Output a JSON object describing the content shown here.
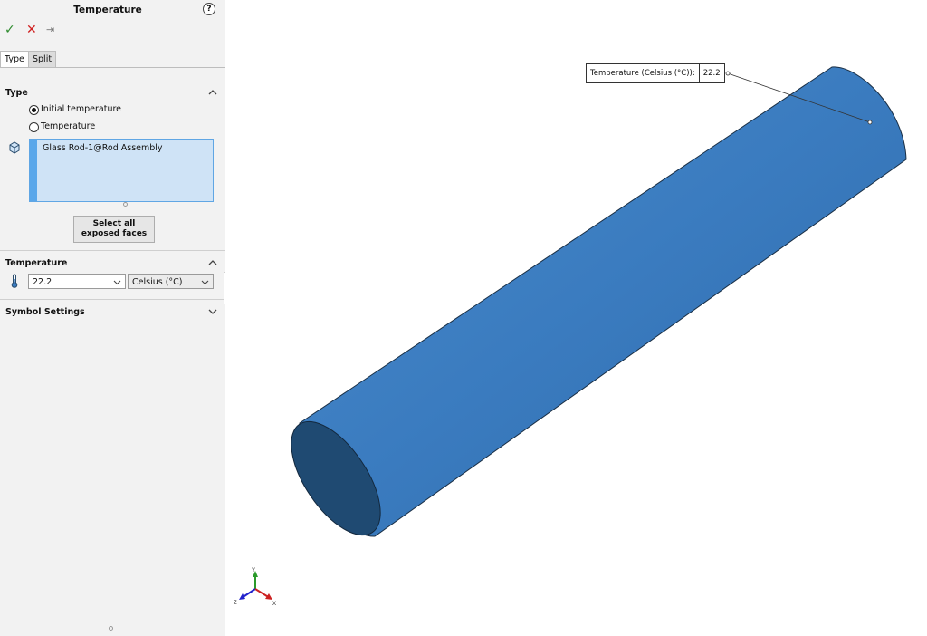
{
  "panel": {
    "title": "Temperature",
    "help_glyph": "?",
    "actions": {
      "ok_glyph": "✓",
      "cancel_glyph": "✕",
      "pin_glyph": "⇥"
    },
    "tabs": [
      {
        "label": "Type",
        "active": true
      },
      {
        "label": "Split",
        "active": false
      }
    ],
    "type_section": {
      "title": "Type",
      "options": [
        {
          "label": "Initial temperature",
          "selected": true
        },
        {
          "label": "Temperature",
          "selected": false
        }
      ],
      "selection_items": [
        "Glass Rod-1@Rod Assembly"
      ],
      "select_button": "Select all exposed faces"
    },
    "temperature_section": {
      "title": "Temperature",
      "value": "22.2",
      "unit": "Celsius (°C)"
    },
    "symbol_section": {
      "title": "Symbol Settings"
    }
  },
  "viewport": {
    "callout": {
      "label": "Temperature (Celsius (°C)):",
      "value": "22.2"
    },
    "triad": {
      "y": "Y",
      "z": "Z",
      "x": "X"
    }
  },
  "colors": {
    "rod_side": "#3a7bbf",
    "rod_end": "#1f4a72",
    "selection_bg": "#cfe3f6",
    "selection_bar": "#5aa7ea"
  },
  "icons": {
    "expand_up": "chevron-up-icon",
    "expand_down": "chevron-down-icon",
    "thermometer": "thermometer-icon",
    "body": "part-body-icon"
  }
}
